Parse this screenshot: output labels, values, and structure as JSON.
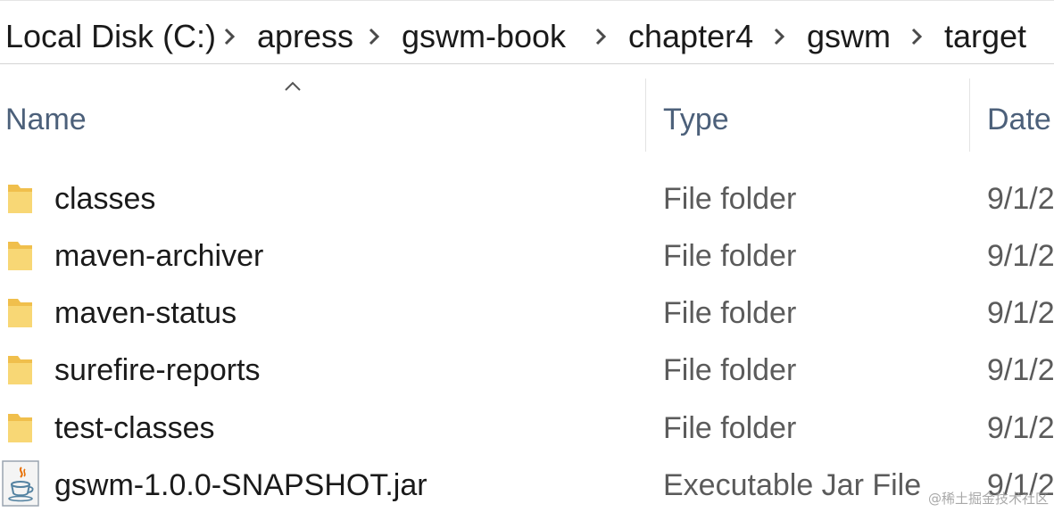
{
  "breadcrumb": {
    "items": [
      "Local Disk (C:)",
      "apress",
      "gswm-book",
      "chapter4",
      "gswm",
      "target"
    ]
  },
  "columns": {
    "name": "Name",
    "type": "Type",
    "date": "Date",
    "sorted_by": "name",
    "sort_icon": "chevron-up-icon"
  },
  "files": [
    {
      "name": "classes",
      "type": "File folder",
      "date": "9/1/2",
      "icon": "folder-icon"
    },
    {
      "name": "maven-archiver",
      "type": "File folder",
      "date": "9/1/2",
      "icon": "folder-icon"
    },
    {
      "name": "maven-status",
      "type": "File folder",
      "date": "9/1/2",
      "icon": "folder-icon"
    },
    {
      "name": "surefire-reports",
      "type": "File folder",
      "date": "9/1/2",
      "icon": "folder-icon"
    },
    {
      "name": "test-classes",
      "type": "File folder",
      "date": "9/1/2",
      "icon": "folder-icon"
    },
    {
      "name": "gswm-1.0.0-SNAPSHOT.jar",
      "type": "Executable Jar File",
      "date": "9/1/2",
      "icon": "java-jar-icon"
    }
  ],
  "watermark": "@稀土掘金技术社区",
  "colors": {
    "folder": "#f3c85a",
    "header_text": "#4c607a",
    "text": "#1a1a1a",
    "muted_text": "#5b5b5b"
  }
}
